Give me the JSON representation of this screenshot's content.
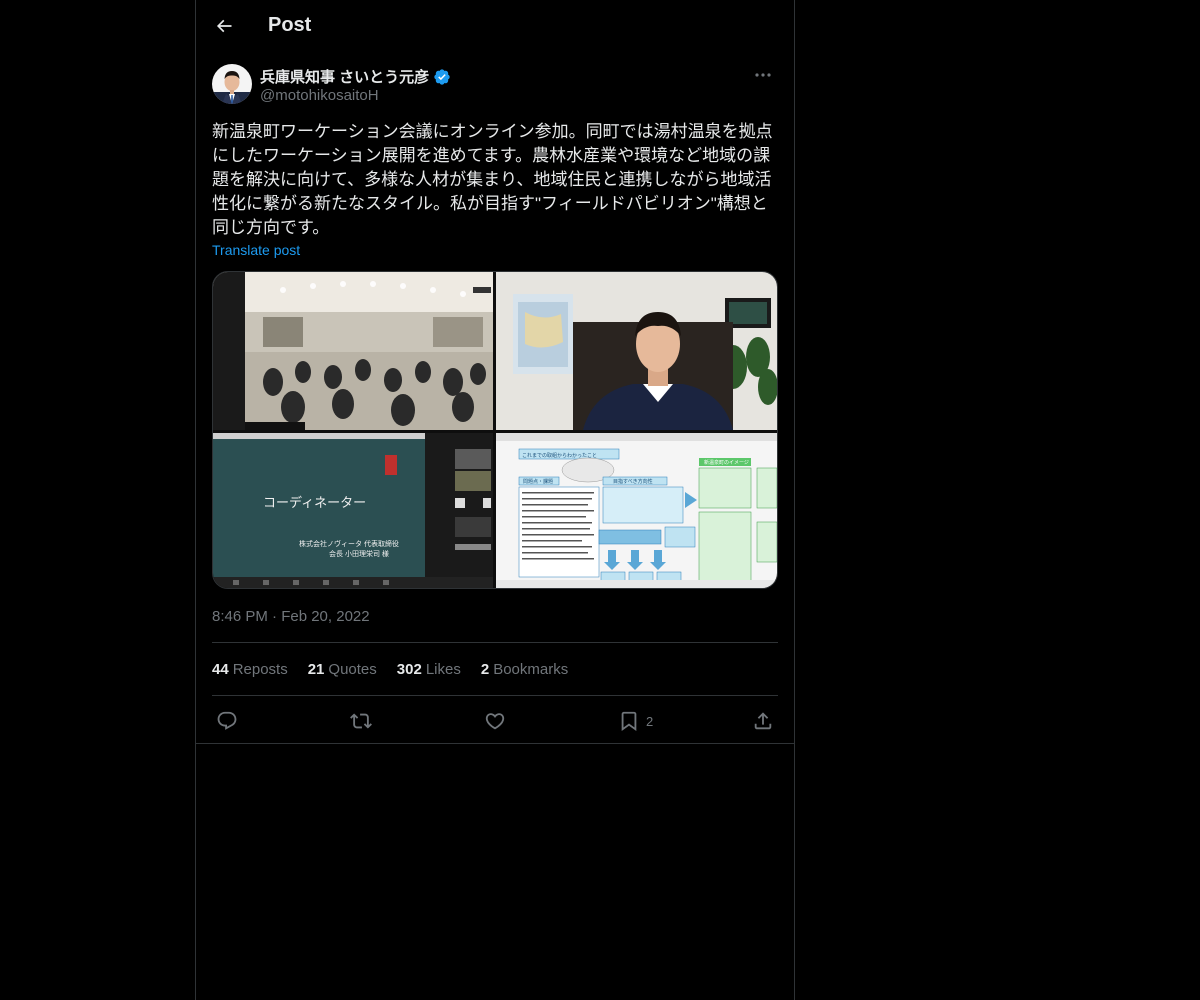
{
  "header": {
    "title": "Post"
  },
  "post": {
    "author_name": "兵庫県知事 さいとう元彦",
    "handle": "@motohikosaitoH",
    "text": "新温泉町ワーケーション会議にオンライン参加。同町では湯村温泉を拠点にしたワーケーション展開を進めてます。農林水産業や環境など地域の課題を解決に向けて、多様な人材が集まり、地域住民と連携しながら地域活性化に繋がる新たなスタイル。私が目指す\"フィールドパビリオン\"構想と同じ方向です。",
    "translate_label": "Translate post",
    "timestamp": "8:46 PM · Feb 20, 2022",
    "media": {
      "slide_title": "コーディネーター",
      "slide_line1": "株式会社ノヴィータ 代表取締役",
      "slide_line2": "会長 小田理栄司 様",
      "chart_header": "これまでの取組からわかったこと",
      "box_left": "問題点・課題",
      "box_mid": "目指すべき方向性",
      "box_right": "新温泉町のイメージ"
    }
  },
  "stats": [
    {
      "count": "44",
      "label": "Reposts"
    },
    {
      "count": "21",
      "label": "Quotes"
    },
    {
      "count": "302",
      "label": "Likes"
    },
    {
      "count": "2",
      "label": "Bookmarks"
    }
  ],
  "actions": {
    "bookmark_count": "2"
  },
  "colors": {
    "background": "#000000",
    "text": "#e7e9ea",
    "secondary": "#71767b",
    "accent": "#1d9bf0",
    "border": "#2f3336"
  },
  "icons": [
    "back-arrow-icon",
    "verified-badge-icon",
    "more-icon",
    "reply-icon",
    "repost-icon",
    "like-icon",
    "bookmark-icon",
    "share-icon"
  ]
}
